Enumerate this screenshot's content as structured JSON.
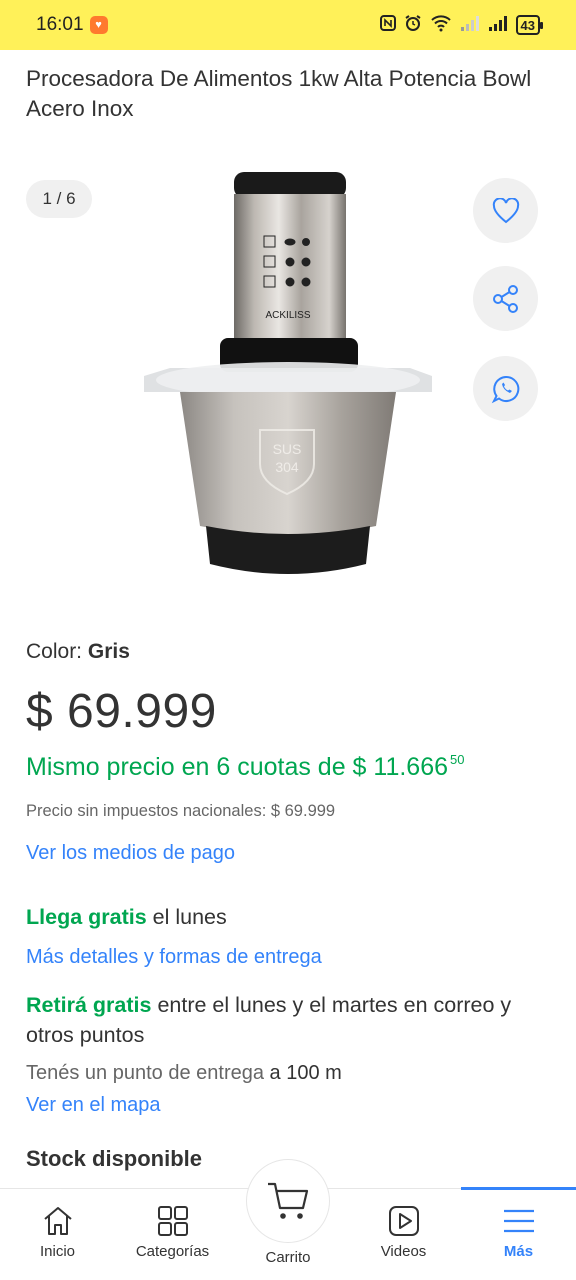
{
  "status_bar": {
    "time": "16:01",
    "battery": "43"
  },
  "product": {
    "title": "Procesadora De Alimentos 1kw Alta Potencia Bowl Acero Inox",
    "image_counter": "1 / 6",
    "image_text_brand": "ACKILISS",
    "image_text_badge_line1": "SUS",
    "image_text_badge_line2": "304",
    "color_label": "Color:",
    "color_value": "Gris",
    "price": "$ 69.999",
    "installments_text": "Mismo precio en 6 cuotas de $ 11.666",
    "installments_cents": "50",
    "tax_text": "Precio sin impuestos nacionales: $ 69.999",
    "payment_link": "Ver los medios de pago"
  },
  "shipping": {
    "delivery_highlight": "Llega gratis",
    "delivery_rest": " el lunes",
    "delivery_link": "Más detalles y formas de entrega",
    "pickup_highlight": "Retirá gratis",
    "pickup_rest": " entre el lunes y el martes en correo y otros puntos",
    "pickup_point_text": "Tenés un punto de entrega ",
    "pickup_point_distance": "a 100 m",
    "map_link": "Ver en el mapa"
  },
  "stock": {
    "label": "Stock disponible"
  },
  "bottom_nav": {
    "items": [
      {
        "label": "Inicio",
        "icon": "home-icon"
      },
      {
        "label": "Categorías",
        "icon": "grid-icon"
      },
      {
        "label": "Carrito",
        "icon": "cart-icon"
      },
      {
        "label": "Videos",
        "icon": "play-icon"
      },
      {
        "label": "Más",
        "icon": "menu-icon"
      }
    ]
  },
  "colors": {
    "status_bar": "#fff159",
    "accent_blue": "#3483fa",
    "green": "#00a650"
  }
}
